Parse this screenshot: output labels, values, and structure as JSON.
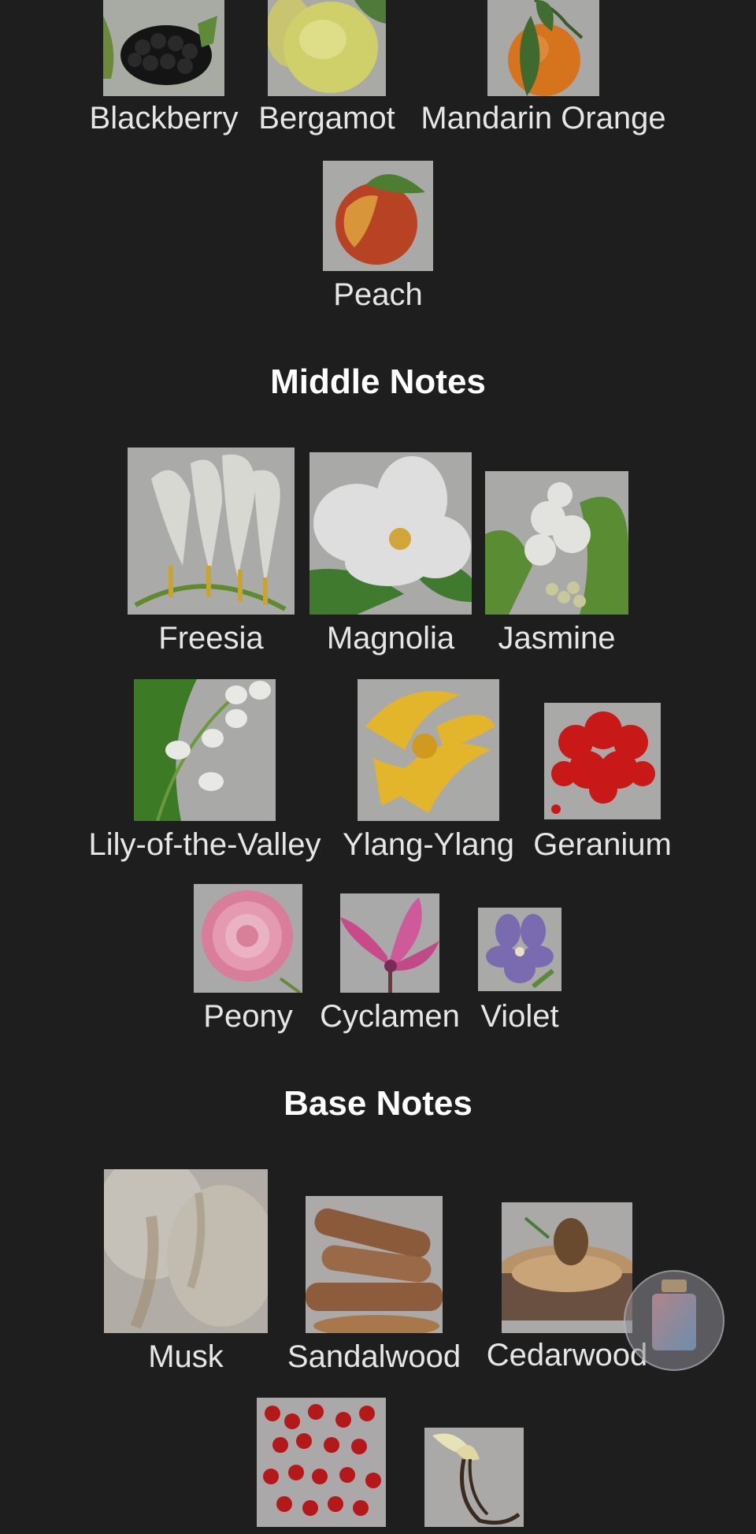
{
  "top_notes": [
    {
      "name": "Blackberry",
      "icon": "blackberry-image"
    },
    {
      "name": "Bergamot",
      "icon": "bergamot-image"
    },
    {
      "name": "Mandarin Orange",
      "icon": "mandarin-orange-image"
    },
    {
      "name": "Peach",
      "icon": "peach-image"
    }
  ],
  "middle": {
    "heading": "Middle Notes",
    "notes": [
      {
        "name": "Freesia",
        "icon": "freesia-image"
      },
      {
        "name": "Magnolia",
        "icon": "magnolia-image"
      },
      {
        "name": "Jasmine",
        "icon": "jasmine-image"
      },
      {
        "name": "Lily-of-the-Valley",
        "icon": "lily-of-the-valley-image"
      },
      {
        "name": "Ylang-Ylang",
        "icon": "ylang-ylang-image"
      },
      {
        "name": "Geranium",
        "icon": "geranium-image"
      },
      {
        "name": "Peony",
        "icon": "peony-image"
      },
      {
        "name": "Cyclamen",
        "icon": "cyclamen-image"
      },
      {
        "name": "Violet",
        "icon": "violet-image"
      }
    ]
  },
  "base": {
    "heading": "Base Notes",
    "notes": [
      {
        "name": "Musk",
        "icon": "musk-image"
      },
      {
        "name": "Sandalwood",
        "icon": "sandalwood-image"
      },
      {
        "name": "Cedarwood",
        "icon": "cedarwood-image"
      },
      {
        "name": "",
        "icon": "pink-pepper-image"
      },
      {
        "name": "",
        "icon": "vanilla-image"
      }
    ]
  },
  "fab": {
    "icon": "perfume-bottle-icon"
  }
}
